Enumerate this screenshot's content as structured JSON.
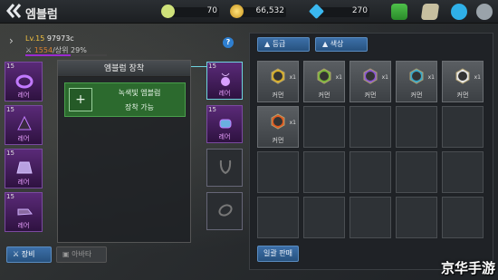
{
  "header": {
    "title": "엠블럼",
    "resources": [
      {
        "name": "key",
        "value": "70",
        "color": "#cfe27a"
      },
      {
        "name": "gold",
        "value": "66,532",
        "color": "#f2c230"
      },
      {
        "name": "gem",
        "value": "270",
        "color": "#3ab8f0"
      }
    ]
  },
  "player": {
    "level_label": "Lv.15",
    "level_code": "97973c",
    "power": "1554",
    "rank": "/상위 29%",
    "exp_fraction": 0.55
  },
  "left_slots": [
    {
      "level": "15",
      "grade": "레어",
      "icon": "purple-ring-icon"
    },
    {
      "level": "15",
      "grade": "레어",
      "icon": "purple-hood-icon"
    },
    {
      "level": "15",
      "grade": "레어",
      "icon": "purple-skirt-icon"
    },
    {
      "level": "15",
      "grade": "레어",
      "icon": "purple-boots-icon"
    }
  ],
  "center": {
    "header": "엠블럼 장착",
    "equip_line1": "녹색빛 엠블럼",
    "equip_line2": "장착 가능"
  },
  "right_slots": [
    {
      "level": "15",
      "grade": "레어",
      "icon": "purple-amulet-icon"
    },
    {
      "level": "15",
      "grade": "레어",
      "icon": "purple-bracer-icon"
    },
    {
      "level": "",
      "grade": "",
      "icon": "necklace-outline-icon"
    },
    {
      "level": "",
      "grade": "",
      "icon": "ring-outline-icon"
    }
  ],
  "inventory": {
    "sort_grade": "▲ 등급",
    "sort_color": "▲ 색상",
    "items": [
      {
        "grade": "커먼",
        "count": "x1",
        "color": "#d9b02a"
      },
      {
        "grade": "커먼",
        "count": "x1",
        "color": "#7ab83a"
      },
      {
        "grade": "커먼",
        "count": "x1",
        "color": "#8a58d0"
      },
      {
        "grade": "커먼",
        "count": "x1",
        "color": "#3aa8c8"
      },
      {
        "grade": "커먼",
        "count": "x1",
        "color": "#e8e8e8"
      },
      {
        "grade": "커먼",
        "count": "x1",
        "color": "#e05a20"
      }
    ],
    "sell_label": "일괄 판매"
  },
  "tabs": {
    "equip": "장비",
    "avatar": "아바타"
  },
  "watermark": "京华手游",
  "help": "?"
}
